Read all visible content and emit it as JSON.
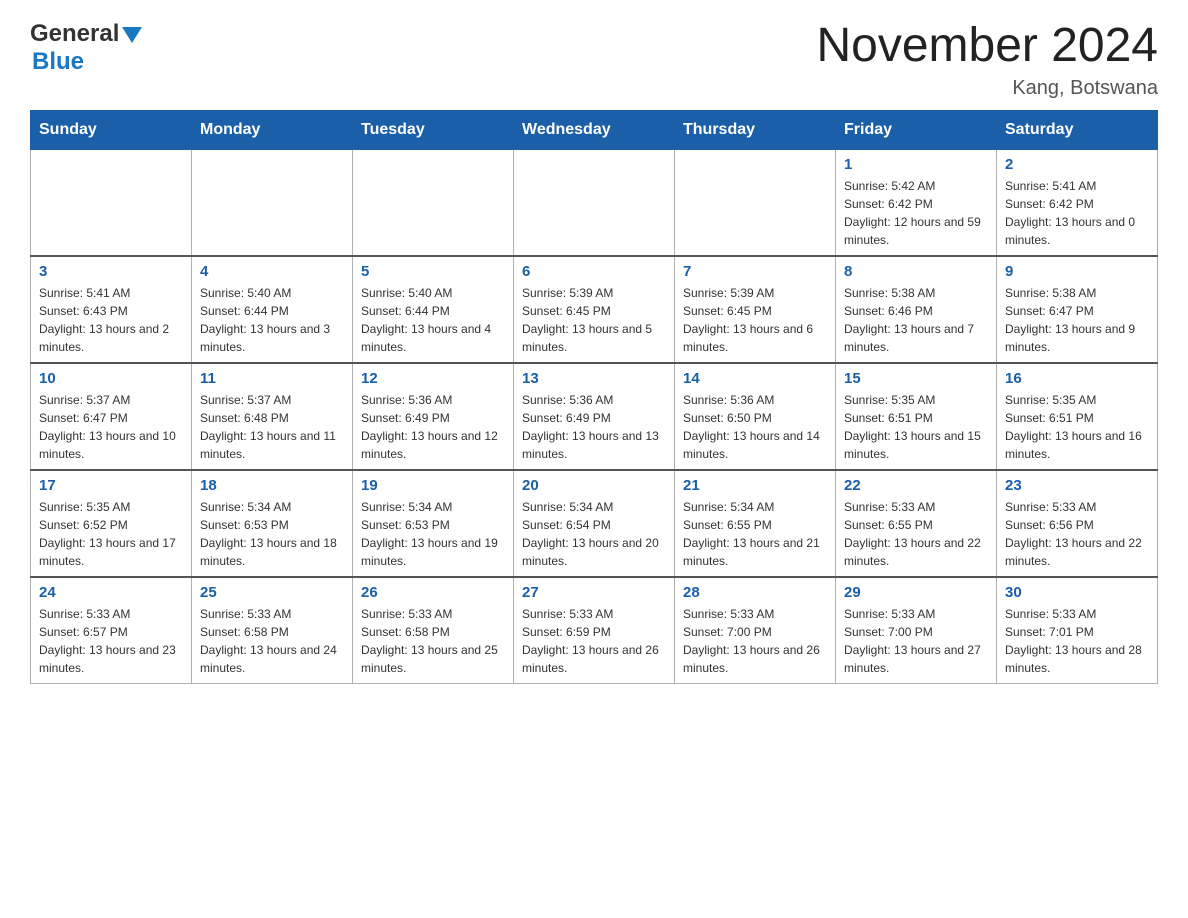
{
  "header": {
    "logo_general": "General",
    "logo_blue": "Blue",
    "title": "November 2024",
    "subtitle": "Kang, Botswana"
  },
  "weekdays": [
    "Sunday",
    "Monday",
    "Tuesday",
    "Wednesday",
    "Thursday",
    "Friday",
    "Saturday"
  ],
  "weeks": [
    [
      {
        "day": "",
        "sunrise": "",
        "sunset": "",
        "daylight": ""
      },
      {
        "day": "",
        "sunrise": "",
        "sunset": "",
        "daylight": ""
      },
      {
        "day": "",
        "sunrise": "",
        "sunset": "",
        "daylight": ""
      },
      {
        "day": "",
        "sunrise": "",
        "sunset": "",
        "daylight": ""
      },
      {
        "day": "",
        "sunrise": "",
        "sunset": "",
        "daylight": ""
      },
      {
        "day": "1",
        "sunrise": "Sunrise: 5:42 AM",
        "sunset": "Sunset: 6:42 PM",
        "daylight": "Daylight: 12 hours and 59 minutes."
      },
      {
        "day": "2",
        "sunrise": "Sunrise: 5:41 AM",
        "sunset": "Sunset: 6:42 PM",
        "daylight": "Daylight: 13 hours and 0 minutes."
      }
    ],
    [
      {
        "day": "3",
        "sunrise": "Sunrise: 5:41 AM",
        "sunset": "Sunset: 6:43 PM",
        "daylight": "Daylight: 13 hours and 2 minutes."
      },
      {
        "day": "4",
        "sunrise": "Sunrise: 5:40 AM",
        "sunset": "Sunset: 6:44 PM",
        "daylight": "Daylight: 13 hours and 3 minutes."
      },
      {
        "day": "5",
        "sunrise": "Sunrise: 5:40 AM",
        "sunset": "Sunset: 6:44 PM",
        "daylight": "Daylight: 13 hours and 4 minutes."
      },
      {
        "day": "6",
        "sunrise": "Sunrise: 5:39 AM",
        "sunset": "Sunset: 6:45 PM",
        "daylight": "Daylight: 13 hours and 5 minutes."
      },
      {
        "day": "7",
        "sunrise": "Sunrise: 5:39 AM",
        "sunset": "Sunset: 6:45 PM",
        "daylight": "Daylight: 13 hours and 6 minutes."
      },
      {
        "day": "8",
        "sunrise": "Sunrise: 5:38 AM",
        "sunset": "Sunset: 6:46 PM",
        "daylight": "Daylight: 13 hours and 7 minutes."
      },
      {
        "day": "9",
        "sunrise": "Sunrise: 5:38 AM",
        "sunset": "Sunset: 6:47 PM",
        "daylight": "Daylight: 13 hours and 9 minutes."
      }
    ],
    [
      {
        "day": "10",
        "sunrise": "Sunrise: 5:37 AM",
        "sunset": "Sunset: 6:47 PM",
        "daylight": "Daylight: 13 hours and 10 minutes."
      },
      {
        "day": "11",
        "sunrise": "Sunrise: 5:37 AM",
        "sunset": "Sunset: 6:48 PM",
        "daylight": "Daylight: 13 hours and 11 minutes."
      },
      {
        "day": "12",
        "sunrise": "Sunrise: 5:36 AM",
        "sunset": "Sunset: 6:49 PM",
        "daylight": "Daylight: 13 hours and 12 minutes."
      },
      {
        "day": "13",
        "sunrise": "Sunrise: 5:36 AM",
        "sunset": "Sunset: 6:49 PM",
        "daylight": "Daylight: 13 hours and 13 minutes."
      },
      {
        "day": "14",
        "sunrise": "Sunrise: 5:36 AM",
        "sunset": "Sunset: 6:50 PM",
        "daylight": "Daylight: 13 hours and 14 minutes."
      },
      {
        "day": "15",
        "sunrise": "Sunrise: 5:35 AM",
        "sunset": "Sunset: 6:51 PM",
        "daylight": "Daylight: 13 hours and 15 minutes."
      },
      {
        "day": "16",
        "sunrise": "Sunrise: 5:35 AM",
        "sunset": "Sunset: 6:51 PM",
        "daylight": "Daylight: 13 hours and 16 minutes."
      }
    ],
    [
      {
        "day": "17",
        "sunrise": "Sunrise: 5:35 AM",
        "sunset": "Sunset: 6:52 PM",
        "daylight": "Daylight: 13 hours and 17 minutes."
      },
      {
        "day": "18",
        "sunrise": "Sunrise: 5:34 AM",
        "sunset": "Sunset: 6:53 PM",
        "daylight": "Daylight: 13 hours and 18 minutes."
      },
      {
        "day": "19",
        "sunrise": "Sunrise: 5:34 AM",
        "sunset": "Sunset: 6:53 PM",
        "daylight": "Daylight: 13 hours and 19 minutes."
      },
      {
        "day": "20",
        "sunrise": "Sunrise: 5:34 AM",
        "sunset": "Sunset: 6:54 PM",
        "daylight": "Daylight: 13 hours and 20 minutes."
      },
      {
        "day": "21",
        "sunrise": "Sunrise: 5:34 AM",
        "sunset": "Sunset: 6:55 PM",
        "daylight": "Daylight: 13 hours and 21 minutes."
      },
      {
        "day": "22",
        "sunrise": "Sunrise: 5:33 AM",
        "sunset": "Sunset: 6:55 PM",
        "daylight": "Daylight: 13 hours and 22 minutes."
      },
      {
        "day": "23",
        "sunrise": "Sunrise: 5:33 AM",
        "sunset": "Sunset: 6:56 PM",
        "daylight": "Daylight: 13 hours and 22 minutes."
      }
    ],
    [
      {
        "day": "24",
        "sunrise": "Sunrise: 5:33 AM",
        "sunset": "Sunset: 6:57 PM",
        "daylight": "Daylight: 13 hours and 23 minutes."
      },
      {
        "day": "25",
        "sunrise": "Sunrise: 5:33 AM",
        "sunset": "Sunset: 6:58 PM",
        "daylight": "Daylight: 13 hours and 24 minutes."
      },
      {
        "day": "26",
        "sunrise": "Sunrise: 5:33 AM",
        "sunset": "Sunset: 6:58 PM",
        "daylight": "Daylight: 13 hours and 25 minutes."
      },
      {
        "day": "27",
        "sunrise": "Sunrise: 5:33 AM",
        "sunset": "Sunset: 6:59 PM",
        "daylight": "Daylight: 13 hours and 26 minutes."
      },
      {
        "day": "28",
        "sunrise": "Sunrise: 5:33 AM",
        "sunset": "Sunset: 7:00 PM",
        "daylight": "Daylight: 13 hours and 26 minutes."
      },
      {
        "day": "29",
        "sunrise": "Sunrise: 5:33 AM",
        "sunset": "Sunset: 7:00 PM",
        "daylight": "Daylight: 13 hours and 27 minutes."
      },
      {
        "day": "30",
        "sunrise": "Sunrise: 5:33 AM",
        "sunset": "Sunset: 7:01 PM",
        "daylight": "Daylight: 13 hours and 28 minutes."
      }
    ]
  ]
}
